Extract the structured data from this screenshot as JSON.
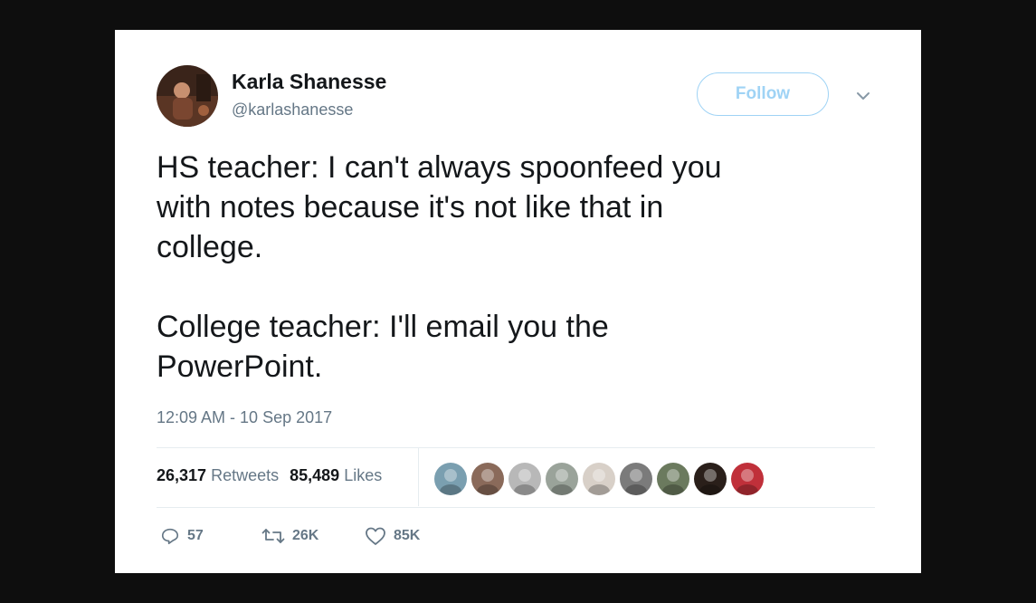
{
  "tweet": {
    "author": {
      "display_name": "Karla Shanesse",
      "handle": "@karlashanesse",
      "avatar_icon": "profile-photo"
    },
    "follow_label": "Follow",
    "paragraphs": [
      "HS teacher: I can't always spoonfeed you\nwith notes because it's not like that in\ncollege.",
      "College teacher: I'll email you the\nPowerPoint."
    ],
    "timestamp": "12:09 AM - 10 Sep 2017",
    "stats": {
      "retweets_count": "26,317",
      "retweets_label": "Retweets",
      "likes_count": "85,489",
      "likes_label": "Likes"
    },
    "liker_avatars": [
      "#7a9fb0",
      "#8a6a5a",
      "#b8b8b8",
      "#9aa39a",
      "#d8d0c8",
      "#7b7b7b",
      "#6b7a5e",
      "#2a1f1a",
      "#c0303a"
    ],
    "actions": {
      "replies": "57",
      "retweets": "26K",
      "likes": "85K"
    },
    "colors": {
      "follow_accent": "#9fd3f5",
      "secondary_text": "#657786",
      "primary_text": "#14171a"
    }
  }
}
